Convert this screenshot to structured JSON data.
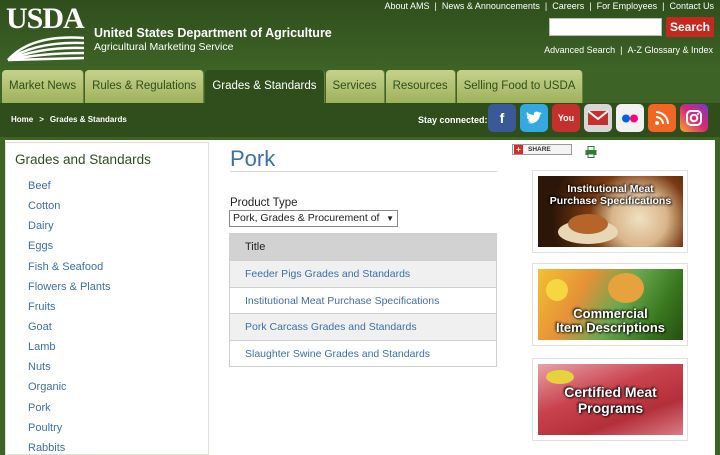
{
  "header": {
    "logo_text": "USDA",
    "org_name": "United States Department of Agriculture",
    "org_sub": "Agricultural Marketing Service",
    "top_links": [
      "About AMS",
      "News & Announcements",
      "Careers",
      "For Employees",
      "Contact Us"
    ],
    "search_button": "Search",
    "search_placeholder": "",
    "util_links": [
      "Advanced Search",
      "A-Z Glossary & Index"
    ]
  },
  "nav": {
    "tabs": [
      "Market News",
      "Rules & Regulations",
      "Grades & Standards",
      "Services",
      "Resources",
      "Selling Food to USDA"
    ],
    "active_tab": "Grades & Standards"
  },
  "breadcrumb": {
    "home": "Home",
    "current": "Grades & Standards"
  },
  "social": {
    "label": "Stay connected:",
    "icons": [
      "facebook-icon",
      "twitter-icon",
      "youtube-icon",
      "email-icon",
      "flickr-icon",
      "rss-icon",
      "instagram-icon"
    ]
  },
  "sidebar": {
    "title": "Grades and Standards",
    "items": [
      "Beef",
      "Cotton",
      "Dairy",
      "Eggs",
      "Fish & Seafood",
      "Flowers & Plants",
      "Fruits",
      "Goat",
      "Lamb",
      "Nuts",
      "Organic",
      "Pork",
      "Poultry",
      "Rabbits"
    ]
  },
  "main": {
    "title": "Pork",
    "filter_label": "Product Type",
    "filter_value": "Pork, Grades & Procurement of",
    "table_header": "Title",
    "rows": [
      "Feeder Pigs Grades and Standards",
      "Institutional Meat Purchase Specifications",
      "Pork Carcass Grades and Standards",
      "Slaughter Swine Grades and Standards"
    ]
  },
  "share": {
    "label": "SHARE"
  },
  "promos": [
    {
      "caption_line1": "Institutional Meat",
      "caption_line2": "Purchase Specifications"
    },
    {
      "caption_line1": "Commercial",
      "caption_line2": "Item Descriptions"
    },
    {
      "caption_line1": "Certified Meat",
      "caption_line2": "Programs"
    }
  ],
  "colors": {
    "header_green": "#2f4e1c",
    "tab_green": "#9eb25c",
    "link_blue": "#3e6fa8",
    "search_red": "#c4281f"
  }
}
